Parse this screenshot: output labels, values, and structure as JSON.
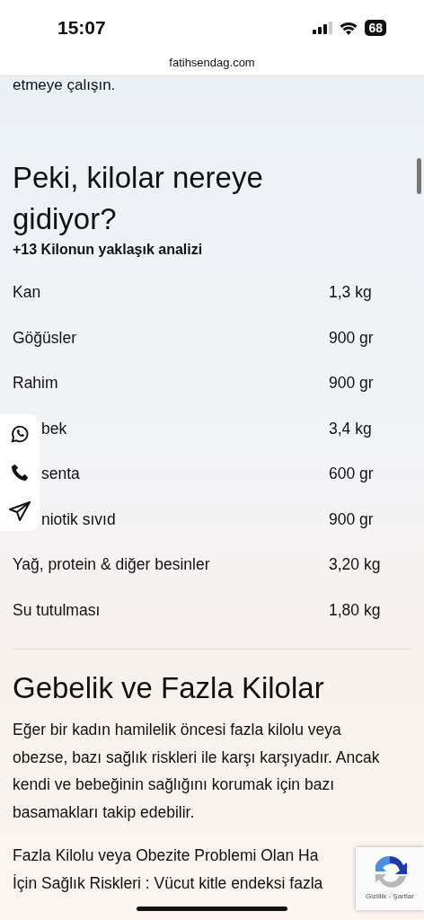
{
  "status_bar": {
    "time": "15:07",
    "battery": "68"
  },
  "address_bar": {
    "url": "fatihsendag.com"
  },
  "intro_tail": "etmeye çalışın.",
  "section": {
    "title": "Peki, kilolar nereye gidiyor?",
    "subtitle": "+13 Kilonun yaklaşık analizi",
    "rows": [
      {
        "label": "Kan",
        "value": "1,3 kg",
        "covered": false
      },
      {
        "label": "Göğüsler",
        "value": "900 gr",
        "covered": false
      },
      {
        "label": "Rahim",
        "value": "900 gr",
        "covered": false
      },
      {
        "label": "bek",
        "value": "3,4 kg",
        "covered": true
      },
      {
        "label": "senta",
        "value": "600 gr",
        "covered": true
      },
      {
        "label": "niotik sıvıd",
        "value": "900 gr",
        "covered": true
      },
      {
        "label": "Yağ, protein & diğer besinler",
        "value": "3,20 kg",
        "covered": false
      },
      {
        "label": "Su tutulması",
        "value": "1,80 kg",
        "covered": false
      }
    ]
  },
  "section2": {
    "title": "Gebelik ve Fazla Kilolar",
    "paragraphs": [
      "Eğer bir kadın hamilelik öncesi fazla kilolu veya obezse, bazı sağlık riskleri ile karşı karşıyadır. Ancak kendi ve bebeğinin sağlığını korumak için bazı basamakları takip edebilir.",
      "Fazla Kilolu veya Obezite Problemi Olan Ha\nİçin Sağlık Riskleri : Vücut kitle endeksi fazla"
    ]
  },
  "contact_panel": {
    "items": [
      {
        "kind": "whatsapp"
      },
      {
        "kind": "phone"
      },
      {
        "kind": "telegram"
      }
    ]
  },
  "recaptcha": {
    "links": "Gizlilik - Şartlar"
  }
}
